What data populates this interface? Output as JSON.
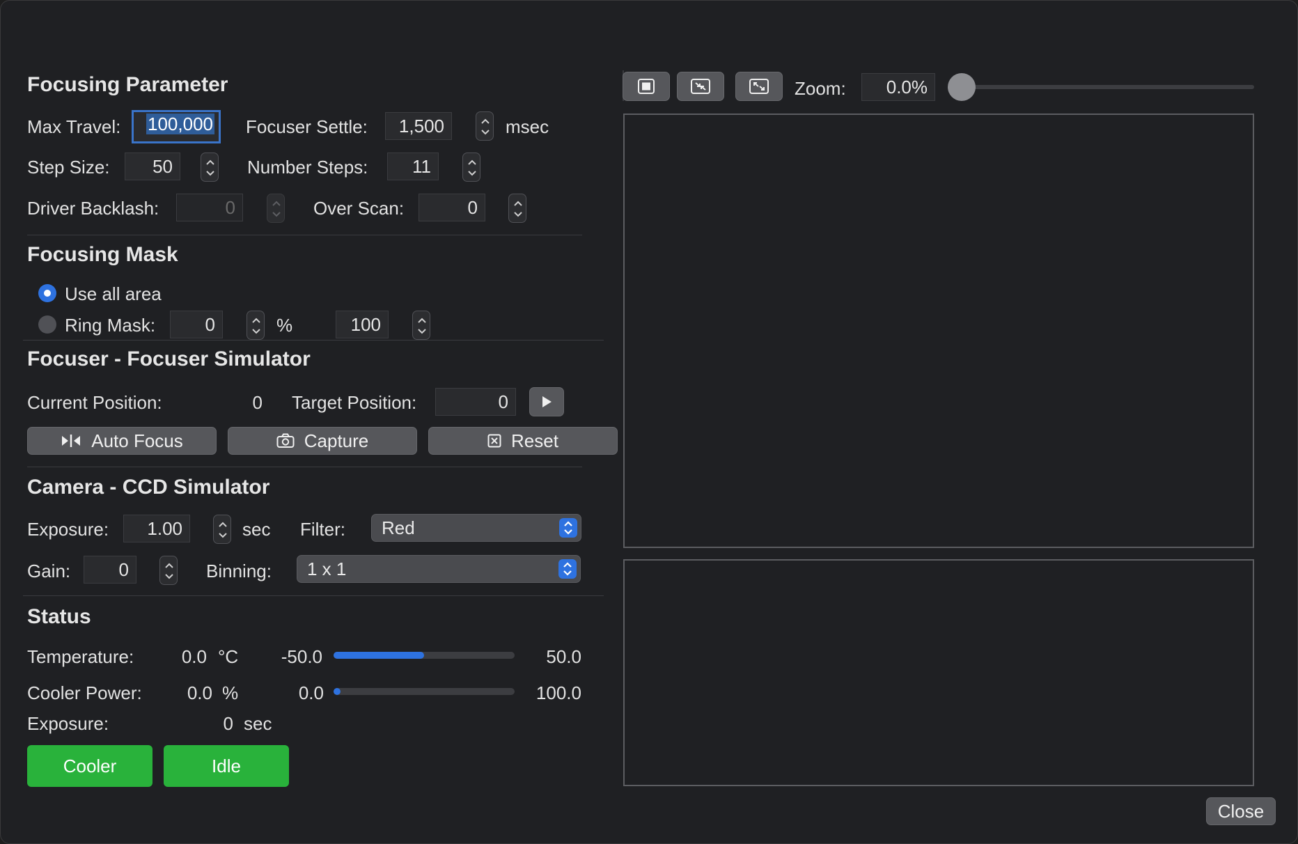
{
  "focusing_parameter": {
    "title": "Focusing Parameter",
    "max_travel_label": "Max Travel:",
    "max_travel_value": "100,000",
    "focuser_settle_label": "Focuser Settle:",
    "focuser_settle_value": "1,500",
    "focuser_settle_unit": "msec",
    "step_size_label": "Step Size:",
    "step_size_value": "50",
    "number_steps_label": "Number Steps:",
    "number_steps_value": "11",
    "driver_backlash_label": "Driver Backlash:",
    "driver_backlash_value": "0",
    "over_scan_label": "Over Scan:",
    "over_scan_value": "0"
  },
  "focusing_mask": {
    "title": "Focusing Mask",
    "use_all_area_label": "Use all area",
    "ring_mask_label": "Ring Mask:",
    "ring_inner_value": "0",
    "ring_unit": "%",
    "ring_outer_value": "100",
    "selected": "use_all_area"
  },
  "focuser": {
    "title": "Focuser - Focuser Simulator",
    "current_position_label": "Current Position:",
    "current_position_value": "0",
    "target_position_label": "Target Position:",
    "target_position_value": "0",
    "auto_focus_label": "Auto Focus",
    "capture_label": "Capture",
    "reset_label": "Reset"
  },
  "camera": {
    "title": "Camera - CCD Simulator",
    "exposure_label": "Exposure:",
    "exposure_value": "1.00",
    "exposure_unit": "sec",
    "filter_label": "Filter:",
    "filter_value": "Red",
    "gain_label": "Gain:",
    "gain_value": "0",
    "binning_label": "Binning:",
    "binning_value": "1 x 1"
  },
  "status": {
    "title": "Status",
    "temperature_label": "Temperature:",
    "temperature_value": "0.0",
    "temperature_unit": "°C",
    "temperature_min": "-50.0",
    "temperature_max": "50.0",
    "temperature_fraction": 0.5,
    "cooler_power_label": "Cooler Power:",
    "cooler_power_value": "0.0",
    "cooler_power_unit": "%",
    "cooler_power_min": "0.0",
    "cooler_power_max": "100.0",
    "cooler_power_fraction": 0.0,
    "exposure_label": "Exposure:",
    "exposure_value": "0",
    "exposure_unit": "sec",
    "cooler_button_label": "Cooler",
    "idle_button_label": "Idle"
  },
  "image_view": {
    "zoom_label": "Zoom:",
    "zoom_value": "0.0%",
    "zoom_fraction": 0.0
  },
  "close_label": "Close",
  "colors": {
    "accent": "#2e72e0",
    "green": "#29b23b",
    "background": "#1f2023"
  }
}
